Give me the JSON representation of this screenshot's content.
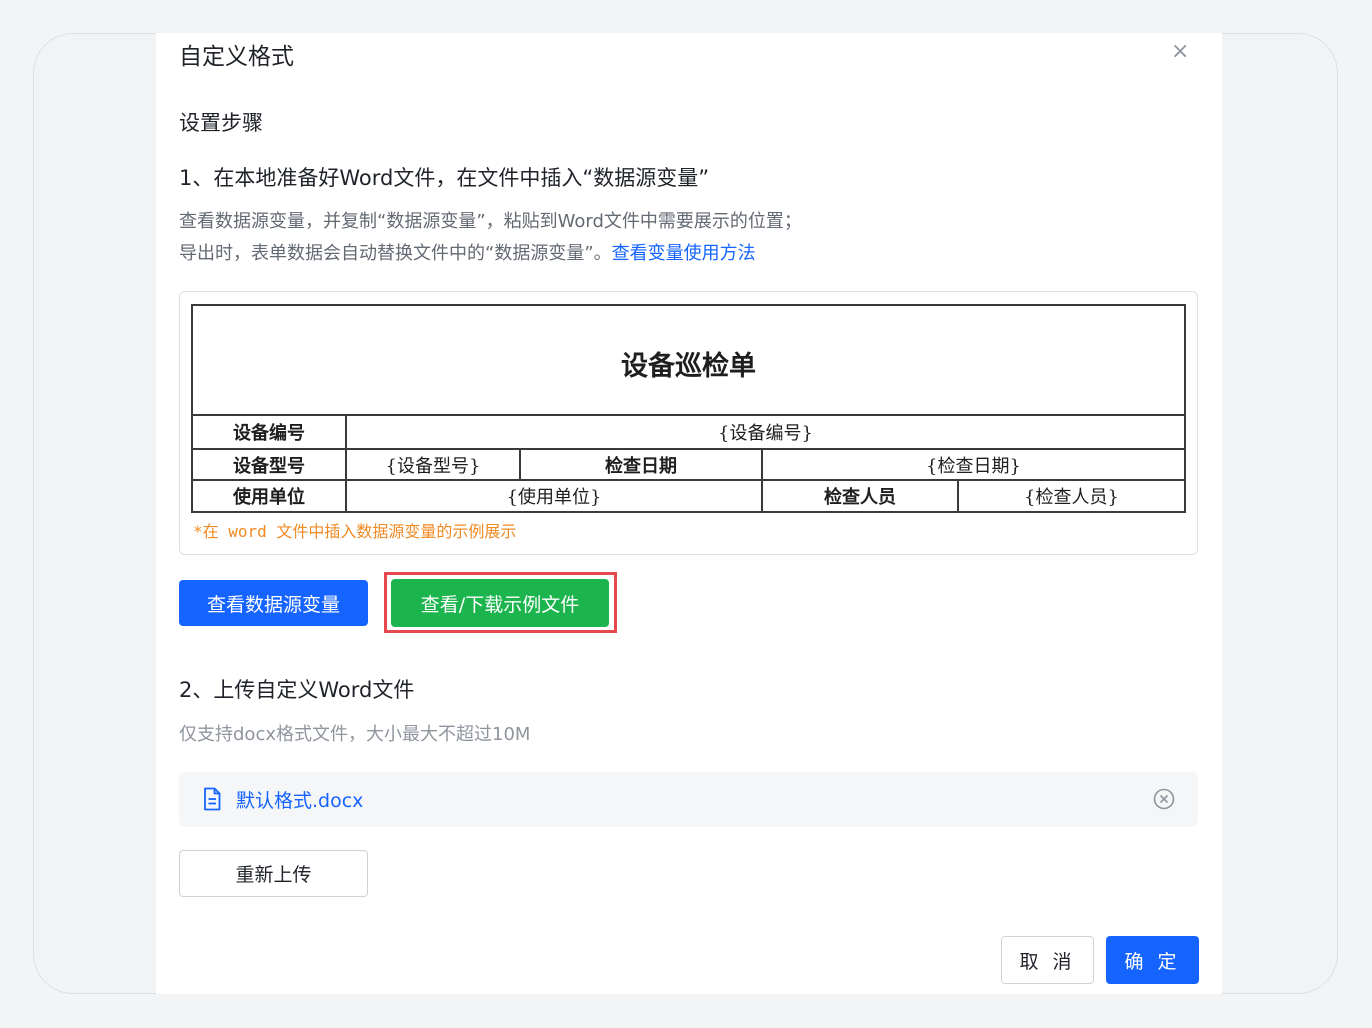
{
  "dialog": {
    "title": "自定义格式",
    "close_icon": "×"
  },
  "steps_heading": "设置步骤",
  "step1": {
    "title": "1、在本地准备好Word文件，在文件中插入“数据源变量”",
    "desc_line1": "查看数据源变量，并复制“数据源变量”，粘贴到Word文件中需要展示的位置；",
    "desc_line2": "导出时，表单数据会自动替换文件中的“数据源变量”。",
    "link": "查看变量使用方法"
  },
  "example": {
    "sheet_title": "设备巡检单",
    "rows": [
      [
        "设备编号",
        "{设备编号}"
      ],
      [
        "设备型号",
        "{设备型号}",
        "检查日期",
        "{检查日期}"
      ],
      [
        "使用单位",
        "{使用单位}",
        "检查人员",
        "{检查人员}"
      ]
    ],
    "note": "*在 word 文件中插入数据源变量的示例展示"
  },
  "buttons": {
    "view_variables": "查看数据源变量",
    "download_example": "查看/下载示例文件",
    "reupload": "重新上传",
    "cancel": "取 消",
    "confirm": "确 定"
  },
  "step2": {
    "title": "2、上传自定义Word文件",
    "desc": "仅支持docx格式文件，大小最大不超过10M"
  },
  "uploaded_file": {
    "name": "默认格式.docx",
    "icon": "document-icon"
  },
  "colors": {
    "primary": "#1664ff",
    "success": "#1bb44d",
    "highlight": "#e5484d",
    "note": "#f08a24"
  }
}
